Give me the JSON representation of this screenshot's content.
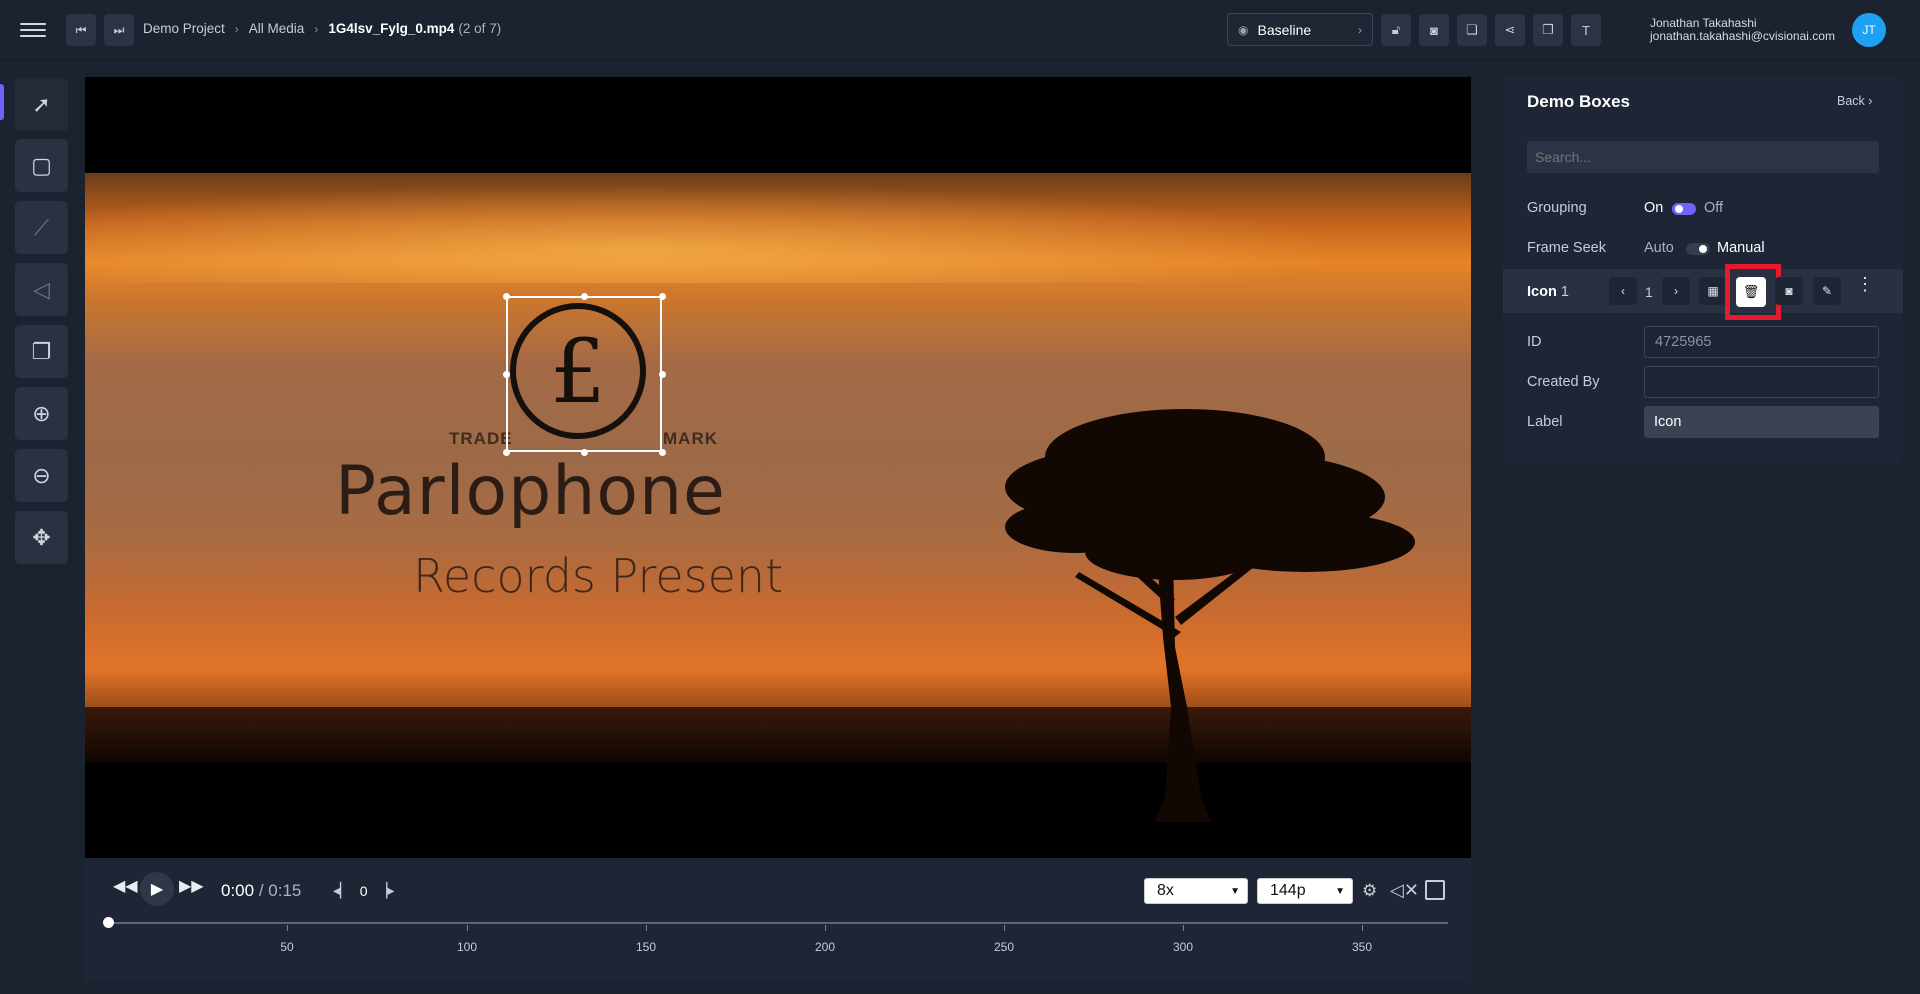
{
  "header": {
    "breadcrumb": [
      "Demo Project",
      "All Media"
    ],
    "filename": "1G4lsv_Fylg_0.mp4",
    "file_position": "(2 of 7)",
    "view_mode": "Baseline",
    "user_name": "Jonathan Takahashi",
    "user_email": "jonathan.takahashi@cvisionai.com",
    "avatar_initials": "JT"
  },
  "video": {
    "logo_main": "Parlophone",
    "logo_sub": "Records Present",
    "trade_left": "TRADE",
    "trade_right": "MARK",
    "pound_symbol": "£"
  },
  "player": {
    "current_time": "0:00",
    "duration": "/ 0:15",
    "frame_number": "0",
    "speed": "8x",
    "quality": "144p",
    "timeline_ticks": [
      "50",
      "100",
      "150",
      "200",
      "250",
      "300",
      "350"
    ]
  },
  "panel": {
    "title": "Demo Boxes",
    "back_label": "Back",
    "search_placeholder": "Search...",
    "grouping_label": "Grouping",
    "grouping_on": "On",
    "grouping_off": "Off",
    "frame_seek_label": "Frame Seek",
    "frame_seek_auto": "Auto",
    "frame_seek_manual": "Manual",
    "object_name": "Icon",
    "object_index": "1",
    "object_frame": "1",
    "id_label": "ID",
    "id_value": "4725965",
    "created_by_label": "Created By",
    "created_by_value": "",
    "label_label": "Label",
    "label_value": "Icon"
  },
  "colors": {
    "accent": "#6d63ff",
    "highlight": "#e6192e",
    "avatar": "#1da1f2"
  }
}
